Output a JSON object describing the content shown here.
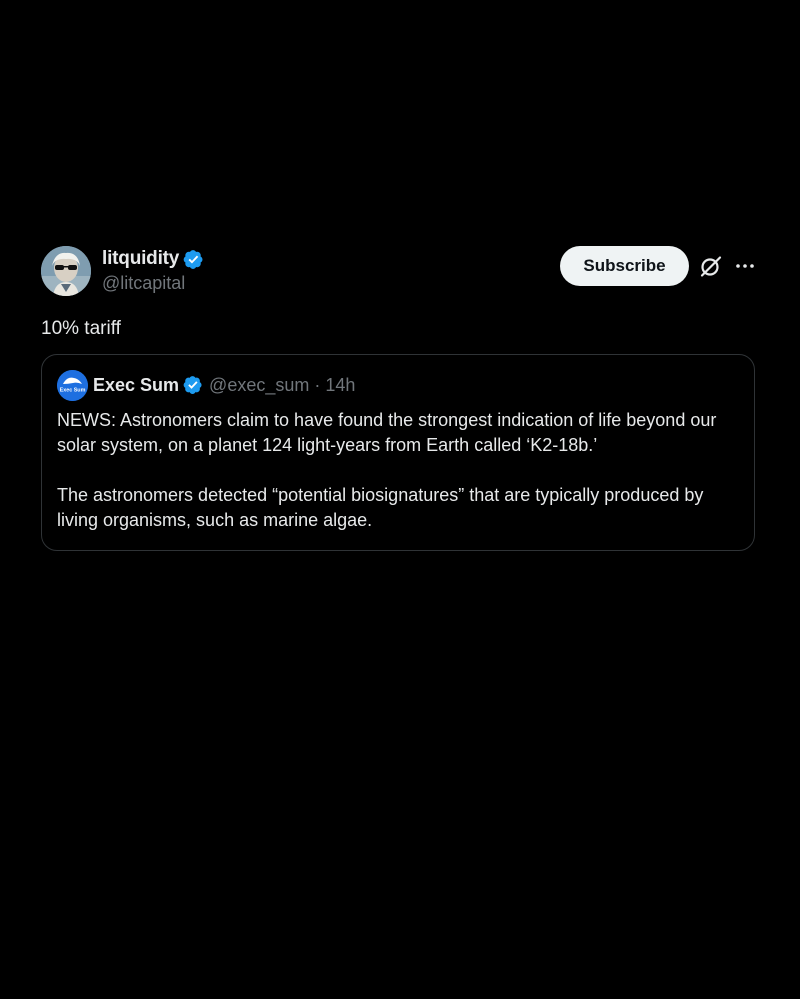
{
  "tweet": {
    "author": {
      "display_name": "litquidity",
      "handle": "@litcapital",
      "avatar_icon": "avatar-sunglasses-portrait",
      "verified_color": "#1d9bf0"
    },
    "actions": {
      "subscribe_label": "Subscribe",
      "grok_icon": "grok-icon",
      "more_icon": "more-icon"
    },
    "text": "10% tariff",
    "quote": {
      "author": {
        "display_name": "Exec Sum",
        "handle": "@exec_sum",
        "avatar_icon": "exec-sum-logo",
        "avatar_text": "Exec Sum"
      },
      "separator": "·",
      "time": "14h",
      "paragraphs": [
        "NEWS: Astronomers claim to have found the strongest indication of life beyond our solar system, on a planet 124 light-years from Earth called ‘K2-18b.’",
        "The astronomers detected “potential biosignatures” that are typically produced by living organisms, such as marine algae."
      ]
    }
  },
  "colors": {
    "background": "#000000",
    "text_primary": "#e7e9ea",
    "text_secondary": "#71767b",
    "border": "#2f3336",
    "button_bg": "#eff3f4",
    "accent": "#1d9bf0"
  }
}
